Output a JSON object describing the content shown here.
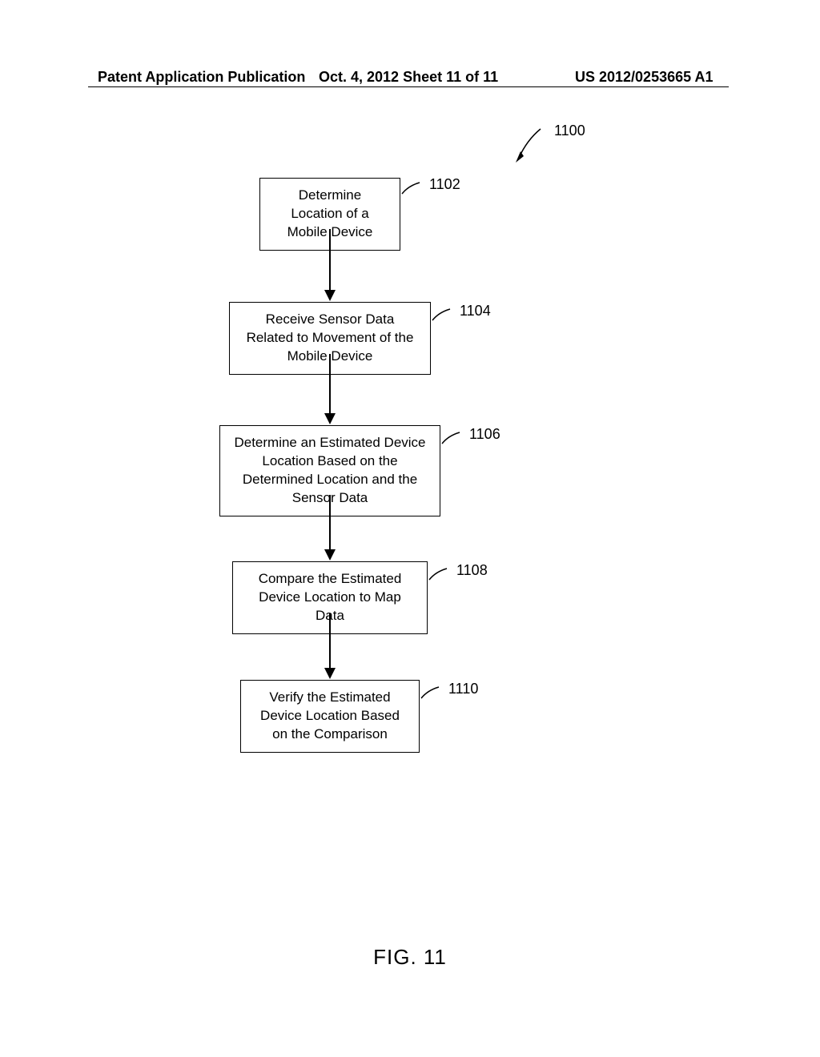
{
  "header": {
    "left": "Patent Application Publication",
    "center": "Oct. 4, 2012  Sheet 11 of 11",
    "right": "US 2012/0253665 A1"
  },
  "diagram": {
    "ref": "1100",
    "boxes": [
      {
        "id": "1102",
        "text": "Determine Location of a Mobile Device"
      },
      {
        "id": "1104",
        "text": "Receive Sensor Data Related to Movement of the Mobile Device"
      },
      {
        "id": "1106",
        "text": "Determine an Estimated Device Location Based on the Determined Location and the Sensor Data"
      },
      {
        "id": "1108",
        "text": "Compare the Estimated Device Location to Map Data"
      },
      {
        "id": "1110",
        "text": "Verify the Estimated Device Location Based on the Comparison"
      }
    ]
  },
  "figure_caption": "FIG. 11"
}
